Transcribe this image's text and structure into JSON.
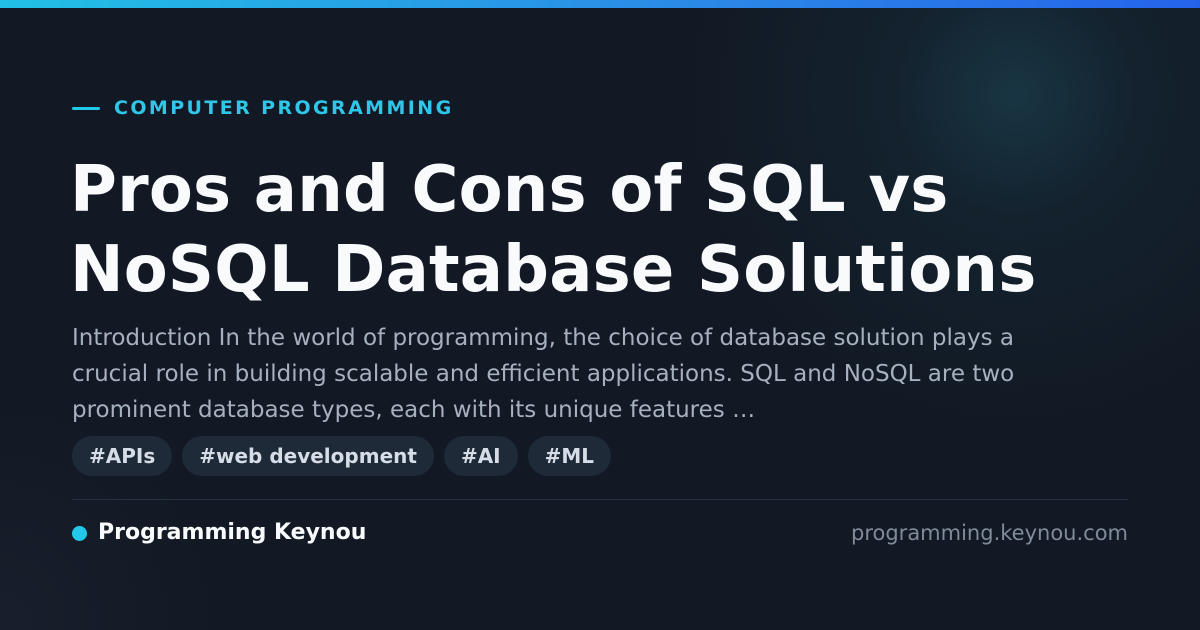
{
  "accent_color": "#22c8e8",
  "category": "COMPUTER PROGRAMMING",
  "title": "Pros and Cons of SQL vs NoSQL Database Solutions",
  "excerpt": "Introduction In the world of programming, the choice of database solution plays a crucial role in building scalable and efficient applications. SQL and NoSQL are two prominent database types, each with its unique features …",
  "tags": [
    "#APIs",
    "#web development",
    "#AI",
    "#ML"
  ],
  "brand": {
    "name": "Programming Keynou"
  },
  "domain": "programming.keynou.com"
}
